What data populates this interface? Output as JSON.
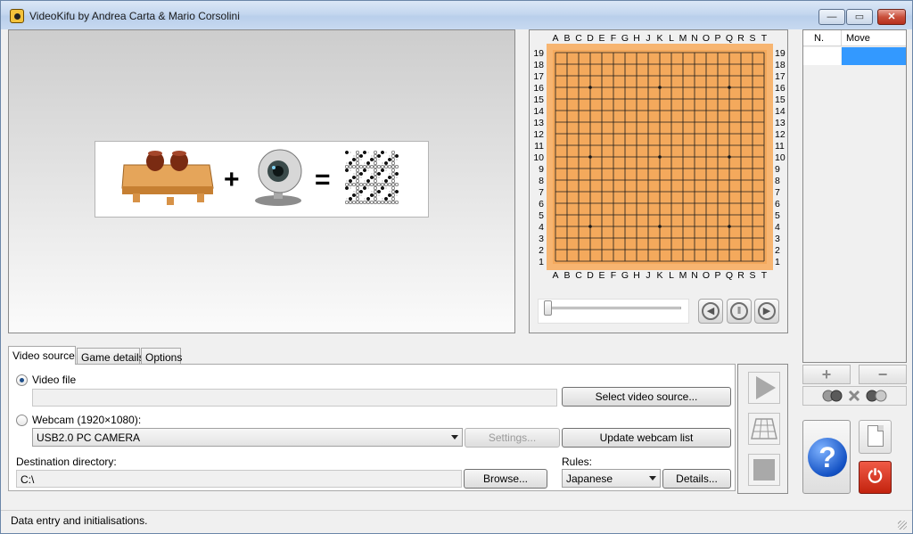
{
  "window": {
    "title": "VideoKifu by Andrea Carta & Mario Corsolini",
    "min_glyph": "—",
    "max_glyph": "▭",
    "close_glyph": "✕"
  },
  "logo": {
    "plus": "+",
    "equals": "="
  },
  "board": {
    "size": 19,
    "columns": [
      "A",
      "B",
      "C",
      "D",
      "E",
      "F",
      "G",
      "H",
      "J",
      "K",
      "L",
      "M",
      "N",
      "O",
      "P",
      "Q",
      "R",
      "S",
      "T"
    ],
    "rows": [
      "19",
      "18",
      "17",
      "16",
      "15",
      "14",
      "13",
      "12",
      "11",
      "10",
      "9",
      "8",
      "7",
      "6",
      "5",
      "4",
      "3",
      "2",
      "1"
    ],
    "board_color": "#f4a95c",
    "frame_color": "#f7b571",
    "line_color": "#1a1a1a"
  },
  "navigation": {
    "prev_glyph": "◀",
    "pause_glyph": "‖",
    "next_glyph": "▶"
  },
  "moves": {
    "col_n": "N.",
    "col_move": "Move",
    "selection_color": "#3399ff"
  },
  "moves_controls": {
    "add_glyph": "+",
    "remove_glyph": "−"
  },
  "tabs": [
    {
      "label": "Video source"
    },
    {
      "label": "Game details"
    },
    {
      "label": "Options"
    }
  ],
  "video_source": {
    "video_file_label": "Video file",
    "video_file_value": "",
    "select_button": "Select video source...",
    "webcam_label": "Webcam (1920×1080):",
    "webcam_value": "USB2.0 PC CAMERA",
    "settings_button": "Settings...",
    "update_button": "Update webcam list",
    "dest_label": "Destination directory:",
    "dest_value": "C:\\",
    "browse_button": "Browse...",
    "rules_label": "Rules:",
    "rules_value": "Japanese",
    "details_button": "Details..."
  },
  "help": {
    "glyph": "?"
  },
  "power": {
    "glyph": "⏻"
  },
  "status": {
    "text": "Data entry and initialisations."
  }
}
